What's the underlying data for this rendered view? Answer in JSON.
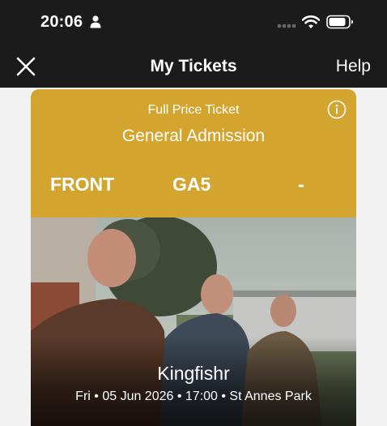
{
  "status_bar": {
    "time": "20:06"
  },
  "nav": {
    "title": "My Tickets",
    "help_label": "Help"
  },
  "ticket": {
    "ticket_type": "Full Price Ticket",
    "admission": "General Admission",
    "section": "FRONT",
    "area": "GA5",
    "seat": "-",
    "accent_color": "#d3a42e"
  },
  "event": {
    "artist": "Kingfishr",
    "details": "Fri • 05 Jun 2026 • 17:00 • St Annes Park"
  },
  "icons": [
    "person-icon",
    "signal-icon",
    "wifi-icon",
    "battery-icon",
    "close-icon",
    "info-icon"
  ]
}
